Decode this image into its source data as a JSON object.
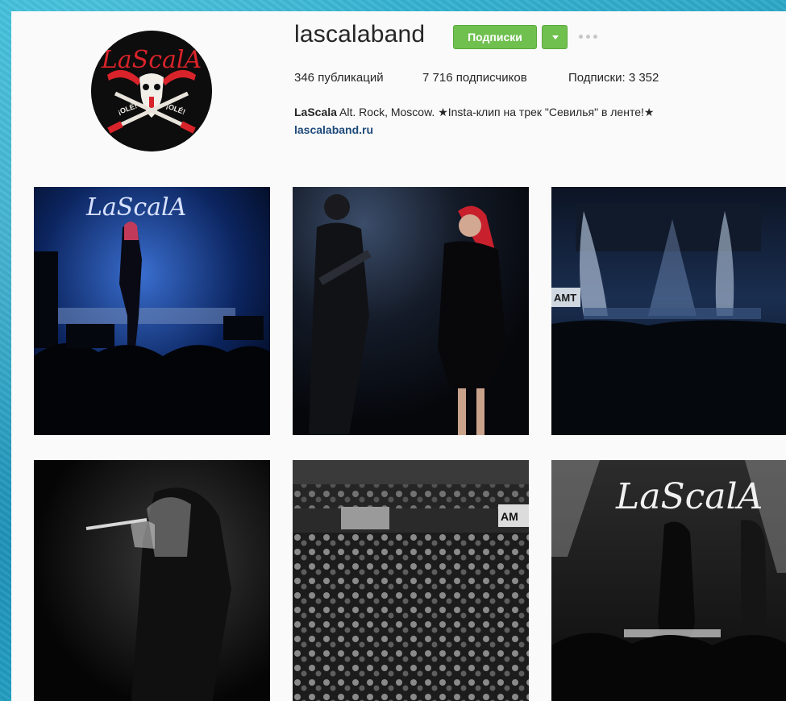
{
  "profile": {
    "username": "lascalaband",
    "follow_label": "Подписки",
    "posts": "346 публикаций",
    "followers": "7 716 подписчиков",
    "following": "Подписки: 3 352",
    "bio_name": "LaScala",
    "bio_text": " Alt. Rock, Moscow. ★Insta-клип на трек \"Севилья\" в ленте!★",
    "website": "lascalaband.ru",
    "avatar_text": "LaScalA",
    "avatar_badge_left": "¡OLÉ!",
    "avatar_badge_right": "¡OLÉ!"
  },
  "photos": [
    {
      "name": "concert-stage-blue",
      "logo": "LaScalA"
    },
    {
      "name": "guitarist-and-singer"
    },
    {
      "name": "stage-smoke-lights",
      "sign": "AMT"
    },
    {
      "name": "singer-bw-closeup"
    },
    {
      "name": "crowd-bw",
      "sign": "AM"
    },
    {
      "name": "stage-logo-bw",
      "logo": "LaScalA"
    }
  ],
  "colors": {
    "follow_green": "#70c050",
    "link_blue": "#1e4a7a",
    "accent_red": "#d8232a"
  }
}
